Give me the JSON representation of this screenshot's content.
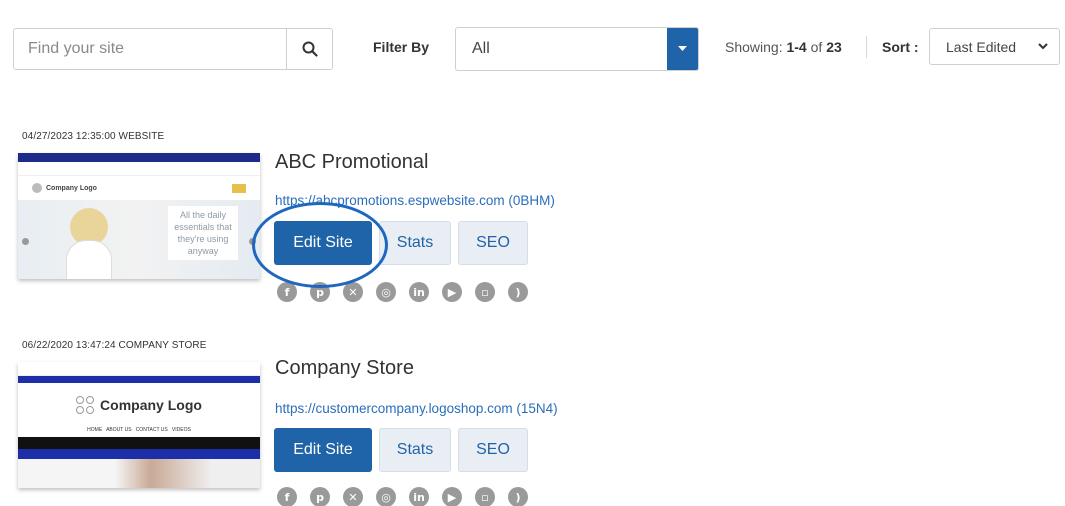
{
  "toolbar": {
    "search_placeholder": "Find your site",
    "filter_label": "Filter By",
    "filter_value": "All",
    "showing_prefix": "Showing:",
    "showing_range": "1-4",
    "showing_of": "of",
    "showing_total": "23",
    "sort_label": "Sort :",
    "sort_value": "Last Edited"
  },
  "sites": [
    {
      "meta": "04/27/2023 12:35:00 WEBSITE",
      "name": "ABC Promotional",
      "url": "https://abcpromotions.espwebsite.com (0BHM)",
      "thumb_logo": "Company Logo",
      "thumb_tagline": "All the daily essentials that they're using anyway",
      "edit_label": "Edit Site",
      "stats_label": "Stats",
      "seo_label": "SEO"
    },
    {
      "meta": "06/22/2020 13:47:24 COMPANY STORE",
      "name": "Company Store",
      "url": "https://customercompany.logoshop.com (15N4)",
      "thumb_logo": "Company Logo",
      "thumb_nav": "HOME   ABOUT US   CONTACT US   VIDEOS",
      "edit_label": "Edit Site",
      "stats_label": "Stats",
      "seo_label": "SEO"
    }
  ],
  "social_icons": [
    "facebook-icon",
    "pinterest-icon",
    "x-icon",
    "instagram-icon",
    "linkedin-icon",
    "youtube-icon",
    "blog-icon",
    "rss-icon"
  ],
  "colors": {
    "primary": "#1f64a8",
    "link": "#2a6ebb",
    "highlight": "#1d67c0"
  }
}
